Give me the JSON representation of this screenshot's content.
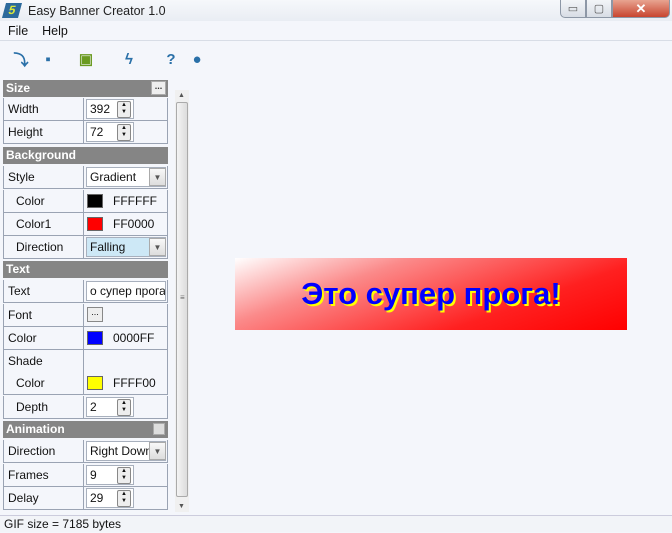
{
  "window": {
    "title": "Easy Banner Creator 1.0",
    "icon_text": "5",
    "minimize": "▭",
    "maximize": "▢",
    "close": "✕"
  },
  "menu": [
    "File",
    "Help"
  ],
  "toolbar": [
    {
      "name": "open-icon",
      "glyph": "⤵",
      "color": "#2a70a8"
    },
    {
      "name": "new-icon",
      "glyph": "▪",
      "color": "#2a70a8"
    },
    {
      "name": "save-icon",
      "glyph": "▣",
      "color": "#6a9a20"
    },
    {
      "name": "lightning-icon",
      "glyph": "ϟ",
      "color": "#2a70a8"
    },
    {
      "name": "help-icon",
      "glyph": "?",
      "color": "#2a70a8"
    },
    {
      "name": "chat-icon",
      "glyph": "●",
      "color": "#2a70a8"
    }
  ],
  "panel": {
    "sections": [
      {
        "title": "Size",
        "extra": "more",
        "more_label": "...",
        "rows": [
          {
            "label": "Width",
            "type": "spin",
            "value": "392"
          },
          {
            "label": "Height",
            "type": "spin",
            "value": "72"
          }
        ]
      },
      {
        "title": "Background",
        "rows": [
          {
            "label": "Style",
            "type": "dropdown",
            "value": "Gradient"
          },
          {
            "label": "Color",
            "indent": true,
            "type": "color",
            "color": "#000000",
            "value": "FFFFFF"
          },
          {
            "label": "Color1",
            "indent": true,
            "type": "color",
            "color": "#ff0000",
            "value": "FF0000"
          },
          {
            "label": "Direction",
            "indent": true,
            "type": "dropdown",
            "value": "Falling",
            "highlight": true
          }
        ]
      },
      {
        "title": "Text",
        "rows": [
          {
            "label": "Text",
            "type": "text",
            "value": "о супер прога!"
          },
          {
            "label": "Font",
            "type": "button",
            "value": "..."
          },
          {
            "label": "Color",
            "type": "color",
            "color": "#0000ff",
            "value": "0000FF"
          },
          {
            "label": "Shade",
            "type": "none"
          },
          {
            "label": "Color",
            "indent": true,
            "type": "color",
            "color": "#ffff00",
            "value": "FFFF00"
          },
          {
            "label": "Depth",
            "indent": true,
            "type": "spin",
            "value": "2"
          }
        ]
      },
      {
        "title": "Animation",
        "extra": "check",
        "rows": [
          {
            "label": "Direction",
            "type": "dropdown",
            "value": "Right Down"
          },
          {
            "label": "Frames",
            "type": "spin",
            "value": "9"
          },
          {
            "label": "Delay",
            "type": "spin",
            "value": "29"
          }
        ]
      }
    ]
  },
  "preview": {
    "banner_text": "Это супер прога!",
    "text_color": "#0000FF",
    "shade_color": "#FFFF00"
  },
  "status": "GIF size = 7185 bytes"
}
